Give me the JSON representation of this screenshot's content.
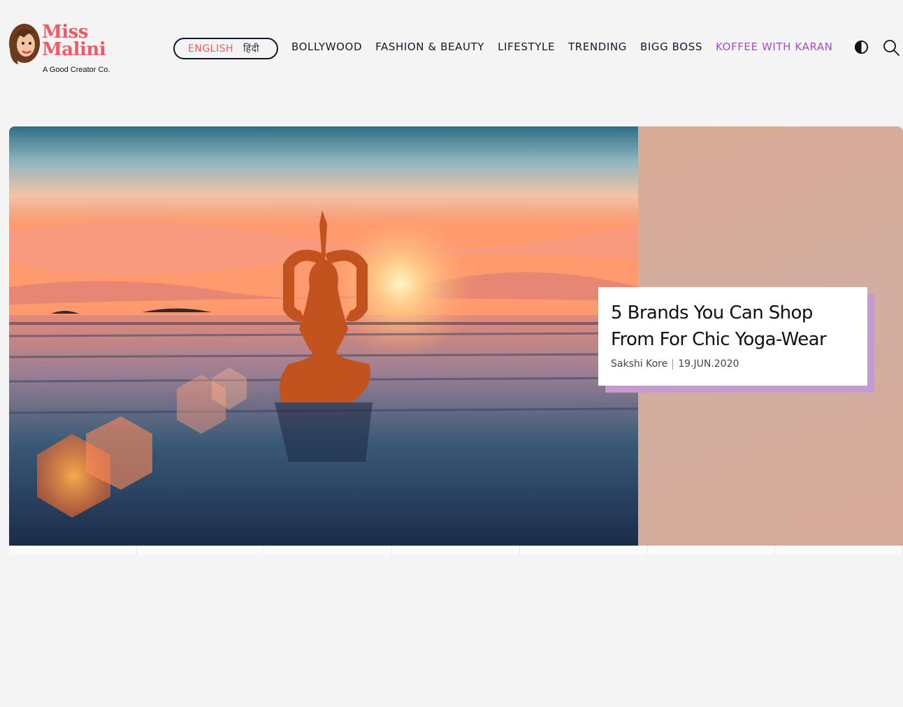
{
  "brand": {
    "name_line1": "Miss",
    "name_line2": "Malini",
    "tagline": "A Good Creator Co."
  },
  "language": {
    "english": "ENGLISH",
    "hindi": "हिंदी"
  },
  "nav": {
    "items": [
      {
        "label": "BOLLYWOOD"
      },
      {
        "label": "FASHION & BEAUTY"
      },
      {
        "label": "LIFESTYLE"
      },
      {
        "label": "TRENDING"
      },
      {
        "label": "BIGG BOSS"
      },
      {
        "label": "KOFFEE WITH KARAN",
        "accent": true
      }
    ]
  },
  "icons": {
    "theme_toggle": "contrast-icon",
    "search": "search-icon"
  },
  "hero": {
    "title": "5 Brands You Can Shop From For Chic Yoga-Wear",
    "author": "Sakshi Kore",
    "date": "19.JUN.2020"
  },
  "colors": {
    "brand": "#ef5a66",
    "accent": "#a44fc4",
    "nav_text": "#15172e",
    "card_shadow": "#c49ad0"
  },
  "carousel": {
    "slide_count": 7
  }
}
